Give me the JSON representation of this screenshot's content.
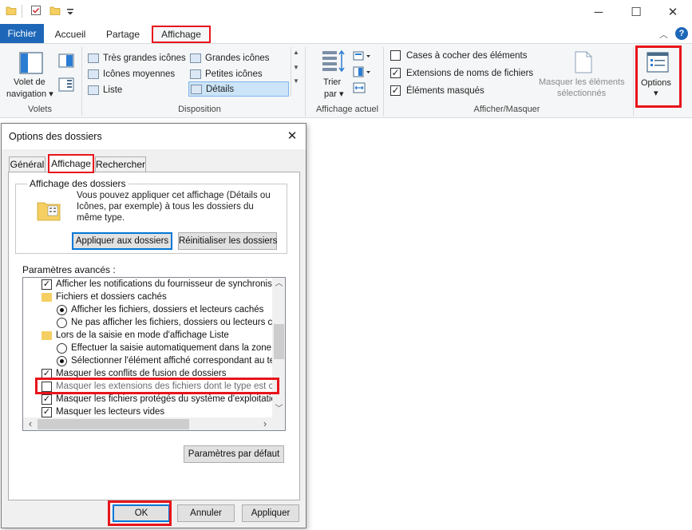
{
  "window": {
    "minimize_glyph": "─",
    "maximize_glyph": "☐",
    "close_glyph": "✕"
  },
  "menu": {
    "tabs": [
      "Fichier",
      "Accueil",
      "Partage",
      "Affichage"
    ],
    "active_tab": "Affichage",
    "chevron_glyph": "︿",
    "help_glyph": "?"
  },
  "ribbon": {
    "volets": {
      "group_label": "Volets",
      "nav_pane_line1": "Volet de",
      "nav_pane_line2": "navigation ▾"
    },
    "disposition": {
      "group_label": "Disposition",
      "items": [
        "Très grandes icônes",
        "Grandes icônes",
        "Icônes moyennes",
        "Petites icônes",
        "Liste",
        "Détails"
      ],
      "selected": "Détails"
    },
    "affichage_actuel": {
      "group_label": "Affichage actuel",
      "sort_line1": "Trier",
      "sort_line2": "par ▾"
    },
    "afficher_masquer": {
      "group_label": "Afficher/Masquer",
      "checkboxes": [
        {
          "label": "Cases à cocher des éléments",
          "checked": false
        },
        {
          "label": "Extensions de noms de fichiers",
          "checked": true
        },
        {
          "label": "Éléments masqués",
          "checked": true
        }
      ],
      "hide_selected_line1": "Masquer les éléments",
      "hide_selected_line2": "sélectionnés"
    },
    "options": {
      "label": "Options",
      "arrow": "▾"
    }
  },
  "dialog": {
    "title": "Options des dossiers",
    "close_glyph": "✕",
    "tabs": [
      "Général",
      "Affichage",
      "Rechercher"
    ],
    "active_tab": "Affichage",
    "folder_view": {
      "title": "Affichage des dossiers",
      "description": "Vous pouvez appliquer cet affichage (Détails ou Icônes, par exemple) à tous les dossiers du même type.",
      "apply_button": "Appliquer aux dossiers",
      "reset_button": "Réinitialiser les dossiers"
    },
    "advanced": {
      "label": "Paramètres avancés :",
      "items": [
        {
          "kind": "checkbox",
          "checked": true,
          "indent": 1,
          "label": "Afficher les notifications du fournisseur de synchronisation"
        },
        {
          "kind": "folder",
          "indent": 1,
          "label": "Fichiers et dossiers cachés"
        },
        {
          "kind": "radio",
          "checked": true,
          "indent": 2,
          "label": "Afficher les fichiers, dossiers et lecteurs cachés"
        },
        {
          "kind": "radio",
          "checked": false,
          "indent": 2,
          "label": "Ne pas afficher les fichiers, dossiers ou lecteurs cachés"
        },
        {
          "kind": "folder",
          "indent": 1,
          "label": "Lors de la saisie en mode d'affichage Liste"
        },
        {
          "kind": "radio",
          "checked": false,
          "indent": 2,
          "label": "Effectuer la saisie automatiquement dans la zone Rec"
        },
        {
          "kind": "radio",
          "checked": true,
          "indent": 2,
          "label": "Sélectionner l'élément affiché correspondant au texte"
        },
        {
          "kind": "checkbox",
          "checked": true,
          "indent": 1,
          "label": "Masquer les conflits de fusion de dossiers"
        },
        {
          "kind": "checkbox",
          "checked": false,
          "indent": 1,
          "label": "Masquer les extensions des fichiers dont le type est connu",
          "highlighted": true
        },
        {
          "kind": "checkbox",
          "checked": true,
          "indent": 1,
          "label": "Masquer les fichiers protégés du système d'exploitation (re"
        },
        {
          "kind": "checkbox",
          "checked": true,
          "indent": 1,
          "label": "Masquer les lecteurs vides"
        }
      ],
      "scroll_up_glyph": "︿",
      "scroll_down_glyph": "﹀",
      "scroll_left_glyph": "‹",
      "scroll_right_glyph": "›",
      "defaults_button": "Paramètres par défaut"
    },
    "buttons": {
      "ok": "OK",
      "cancel": "Annuler",
      "apply": "Appliquer"
    },
    "check_glyph": "✓"
  }
}
